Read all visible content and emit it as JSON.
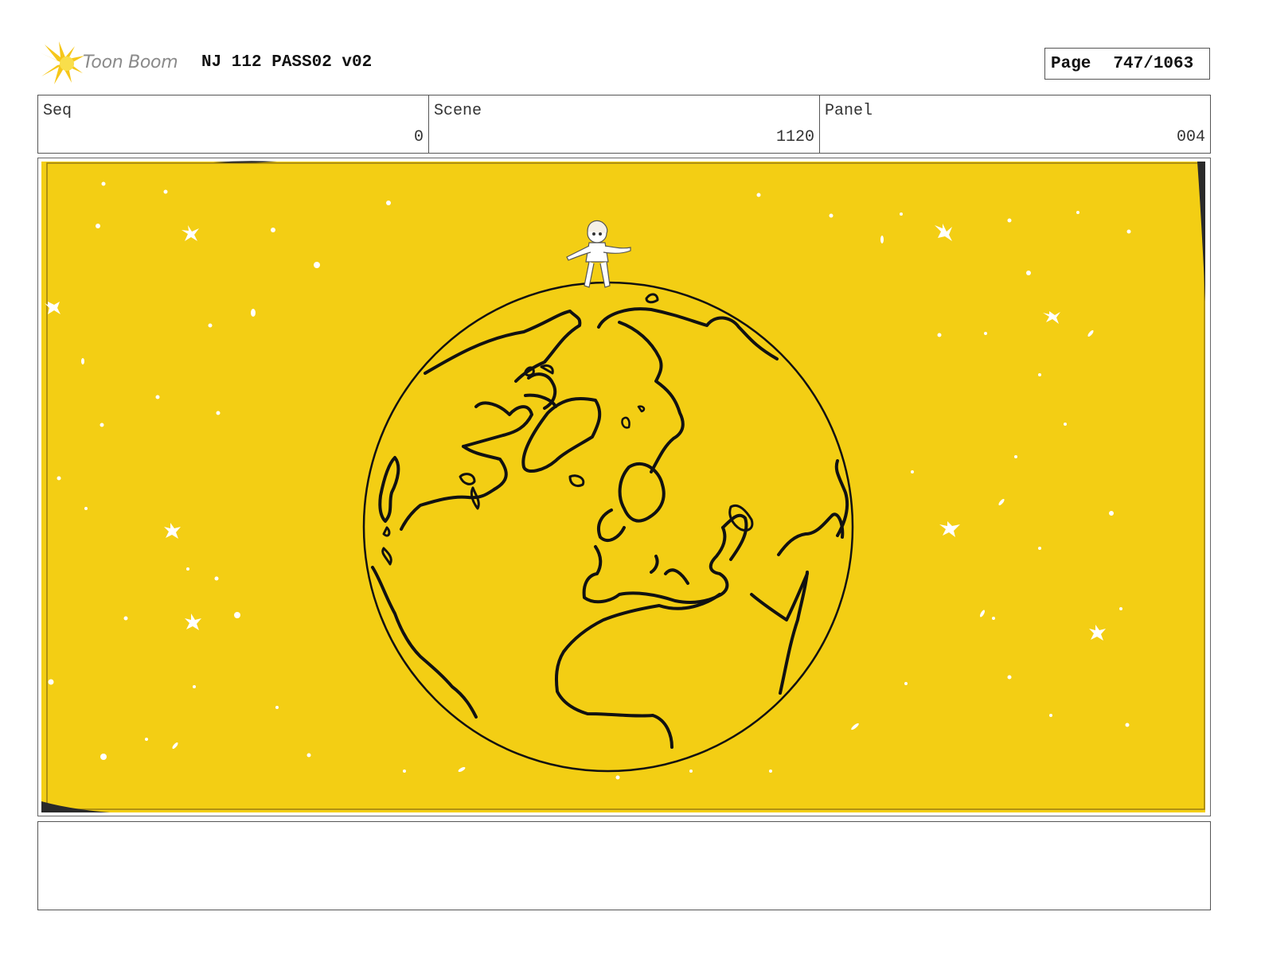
{
  "header": {
    "logo_text": "Toon Boom",
    "title": "NJ 112 PASS02 v02",
    "page_label": "Page",
    "page_number": "747/1063"
  },
  "info": {
    "seq_label": "Seq",
    "seq_value": "0",
    "scene_label": "Scene",
    "scene_value": "1120",
    "panel_label": "Panel",
    "panel_value": "004"
  },
  "panel": {
    "background_color": "#F3CE14",
    "line_color": "#111111"
  },
  "notes": {
    "text": ""
  }
}
